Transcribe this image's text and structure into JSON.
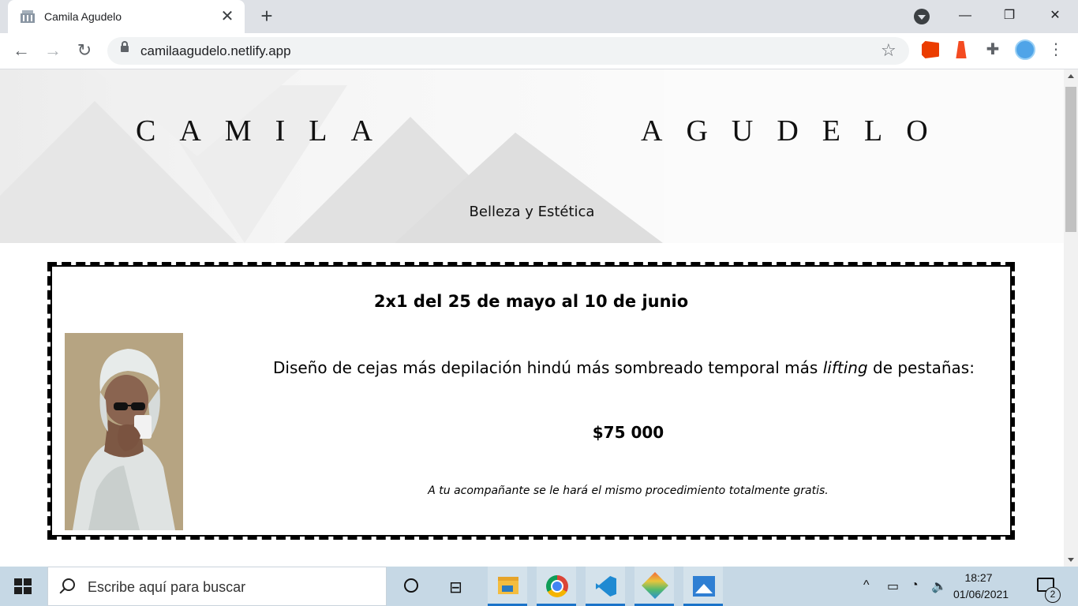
{
  "browser": {
    "tab_title": "Camila Agudelo",
    "url": "camilaagudelo.netlify.app",
    "new_tab_glyph": "+",
    "close_glyph": "✕",
    "window_controls": {
      "minimize": "—",
      "restore": "❐",
      "close": "✕"
    },
    "nav": {
      "back": "←",
      "forward": "→",
      "reload": "↻"
    },
    "bookmark_glyph": "☆",
    "menu_glyph": "⋮",
    "extensions_glyph": "✚"
  },
  "page": {
    "brand_first": "CAMILA",
    "brand_last": "AGUDELO",
    "tagline": "Belleza y Estética",
    "promo": {
      "title": "2x1 del 25 de mayo al 10 de junio",
      "description_before": "Diseño de cejas más depilación hindú más sombreado temporal más ",
      "description_em": "lifting",
      "description_after": " de pestañas:",
      "price": "$75 000",
      "note": "A tu acompañante se le hará el mismo procedimiento totalmente gratis."
    }
  },
  "taskbar": {
    "search_placeholder": "Escribe aquí para buscar",
    "time": "18:27",
    "date": "01/06/2021",
    "notification_count": "2",
    "tray": {
      "chevron": "^",
      "battery": "▭",
      "wifi": "◔",
      "volume": "🔈"
    },
    "taskview_glyph": "⊟"
  },
  "colors": {
    "tab_strip": "#dee1e6",
    "taskbar": "#c6d8e5",
    "promo_image_bg": "#b6a482",
    "active_indicator": "#1a73c9"
  }
}
